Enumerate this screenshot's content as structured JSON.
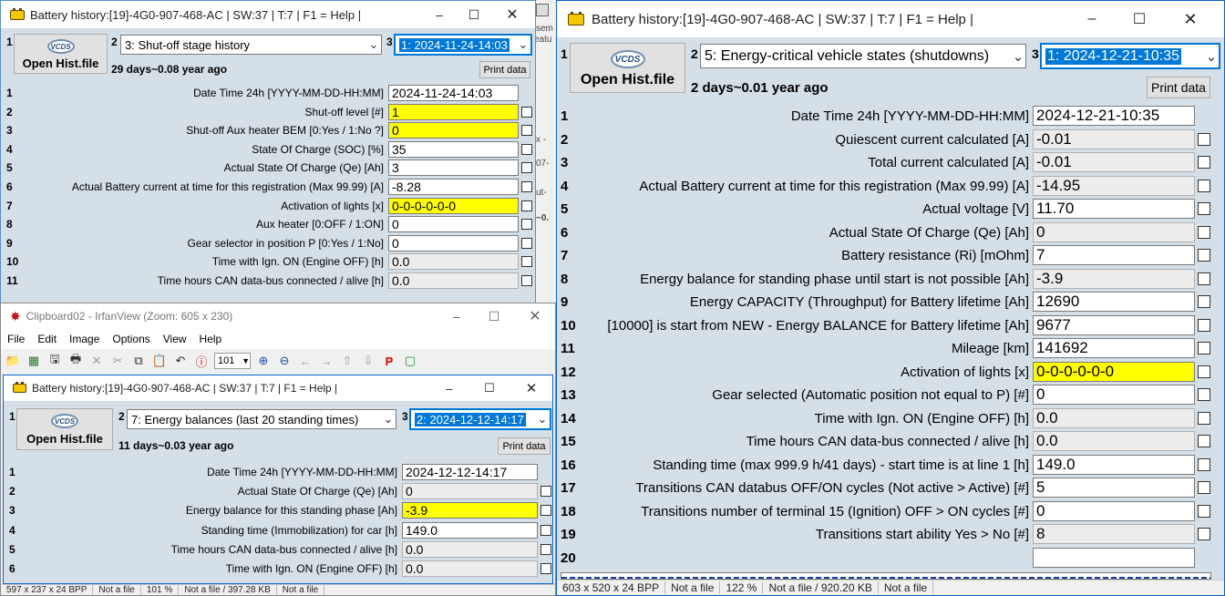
{
  "win1": {
    "title": "Battery history:[19]-4G0-907-468-AC | SW:37 | T:7 | F1 = Help |",
    "open_label": "Open Hist.file",
    "vcds": "VCDS",
    "sel2": "3: Shut-off stage history",
    "sel3": "1: 2024-11-24-14:03",
    "age": "29 days~0.08 year ago",
    "print": "Print data",
    "rows": [
      {
        "n": "1",
        "label": "Date Time 24h [YYYY-MM-DD-HH:MM]",
        "value": "2024-11-24-14:03"
      },
      {
        "n": "2",
        "label": "Shut-off level [#]",
        "value": "1"
      },
      {
        "n": "3",
        "label": "Shut-off Aux heater BEM [0:Yes / 1:No ?]",
        "value": "0"
      },
      {
        "n": "4",
        "label": "State Of Charge (SOC) [%]",
        "value": "35"
      },
      {
        "n": "5",
        "label": "Actual State Of Charge (Qe) [Ah]",
        "value": "3"
      },
      {
        "n": "6",
        "label": "Actual Battery current at time for this registration (Max 99.99) [A]",
        "value": "-8.28"
      },
      {
        "n": "7",
        "label": "Activation of lights [x]",
        "value": "0-0-0-0-0-0"
      },
      {
        "n": "8",
        "label": "Aux heater [0:OFF / 1:ON]",
        "value": "0"
      },
      {
        "n": "9",
        "label": "Gear selector in position P [0:Yes / 1:No]",
        "value": "0"
      },
      {
        "n": "10",
        "label": "Time with Ign. ON (Engine OFF) [h]",
        "value": "0.0"
      },
      {
        "n": "11",
        "label": "Time hours CAN data-bus connected / alive [h]",
        "value": "0.0"
      }
    ]
  },
  "win2": {
    "title": "Battery history:[19]-4G0-907-468-AC | SW:37 | T:7 | F1 = Help |",
    "open_label": "Open Hist.file",
    "vcds": "VCDS",
    "sel2": "5: Energy-critical vehicle states (shutdowns)",
    "sel3": "1: 2024-12-21-10:35",
    "age": "2 days~0.01 year ago",
    "print": "Print data",
    "rows": [
      {
        "n": "1",
        "label": "Date Time 24h [YYYY-MM-DD-HH:MM]",
        "value": "2024-12-21-10:35"
      },
      {
        "n": "2",
        "label": "Quiescent current calculated [A]",
        "value": "-0.01"
      },
      {
        "n": "3",
        "label": "Total current calculated [A]",
        "value": "-0.01"
      },
      {
        "n": "4",
        "label": "Actual Battery current at time for this registration (Max 99.99) [A]",
        "value": "-14.95"
      },
      {
        "n": "5",
        "label": "Actual voltage [V]",
        "value": "11.70"
      },
      {
        "n": "6",
        "label": "Actual State Of Charge (Qe) [Ah]",
        "value": "0"
      },
      {
        "n": "7",
        "label": "Battery resistance (Ri) [mOhm]",
        "value": "7"
      },
      {
        "n": "8",
        "label": "Energy balance for standing phase until start is not possible [Ah]",
        "value": "-3.9"
      },
      {
        "n": "9",
        "label": "Energy CAPACITY (Throughput) for Battery lifetime [Ah]",
        "value": "12690"
      },
      {
        "n": "10",
        "label": "[10000] is start from NEW - Energy BALANCE for Battery lifetime [Ah]",
        "value": "9677"
      },
      {
        "n": "11",
        "label": "Mileage [km]",
        "value": "141692"
      },
      {
        "n": "12",
        "label": "Activation of lights [x]",
        "value": "0-0-0-0-0-0"
      },
      {
        "n": "13",
        "label": "Gear selected (Automatic position not equal to P) [#]",
        "value": "0"
      },
      {
        "n": "14",
        "label": "Time with Ign. ON (Engine OFF) [h]",
        "value": "0.0"
      },
      {
        "n": "15",
        "label": "Time hours CAN data-bus connected / alive [h]",
        "value": "0.0"
      },
      {
        "n": "16",
        "label": "Standing time (max 999.9 h/41 days) - start time is at line 1 [h]",
        "value": "149.0"
      },
      {
        "n": "17",
        "label": "Transitions CAN databus OFF/ON cycles (Not active > Active) [#]",
        "value": "5"
      },
      {
        "n": "18",
        "label": "Transitions number of terminal 15 (Ignition) OFF > ON cycles [#]",
        "value": "0"
      },
      {
        "n": "19",
        "label": "Transitions start ability Yes > No [#]",
        "value": "8"
      },
      {
        "n": "20",
        "label": "",
        "value": ""
      }
    ],
    "status": [
      "603 x 520 x 24 BPP",
      "Not a file",
      "122 %",
      "Not a file / 920.20 KB",
      "Not a file"
    ]
  },
  "irfan": {
    "title": "Clipboard02 - IrfanView (Zoom: 605 x 230)",
    "menu": [
      "File",
      "Edit",
      "Image",
      "Options",
      "View",
      "Help"
    ],
    "zoom": "101",
    "status": [
      "597 x 237 x 24 BPP",
      "Not a file",
      "101 %",
      "Not a file / 397.28 KB",
      "Not a file"
    ]
  },
  "win3": {
    "title": "Battery history:[19]-4G0-907-468-AC | SW:37 | T:7 | F1 = Help |",
    "open_label": "Open Hist.file",
    "vcds": "VCDS",
    "sel2": "7: Energy balances (last 20 standing times)",
    "sel3": "2: 2024-12-12-14:17",
    "age": "11 days~0.03 year ago",
    "print": "Print data",
    "rows": [
      {
        "n": "1",
        "label": "Date Time 24h [YYYY-MM-DD-HH:MM]",
        "value": "2024-12-12-14:17"
      },
      {
        "n": "2",
        "label": "Actual State Of Charge (Qe) [Ah]",
        "value": "0"
      },
      {
        "n": "3",
        "label": "Energy balance for this standing phase [Ah]",
        "value": "-3.9"
      },
      {
        "n": "4",
        "label": "Standing time (Immobilization) for car [h]",
        "value": "149.0"
      },
      {
        "n": "5",
        "label": "Time hours CAN data-bus connected / alive [h]",
        "value": "0.0"
      },
      {
        "n": "6",
        "label": "Time with Ign. ON (Engine OFF) [h]",
        "value": "0.0"
      }
    ]
  },
  "bg_fragments": {
    "a": "sem",
    "b": "eatu",
    "c": "x -",
    "d": "07-",
    "e": "ut-",
    "f": "~0."
  }
}
